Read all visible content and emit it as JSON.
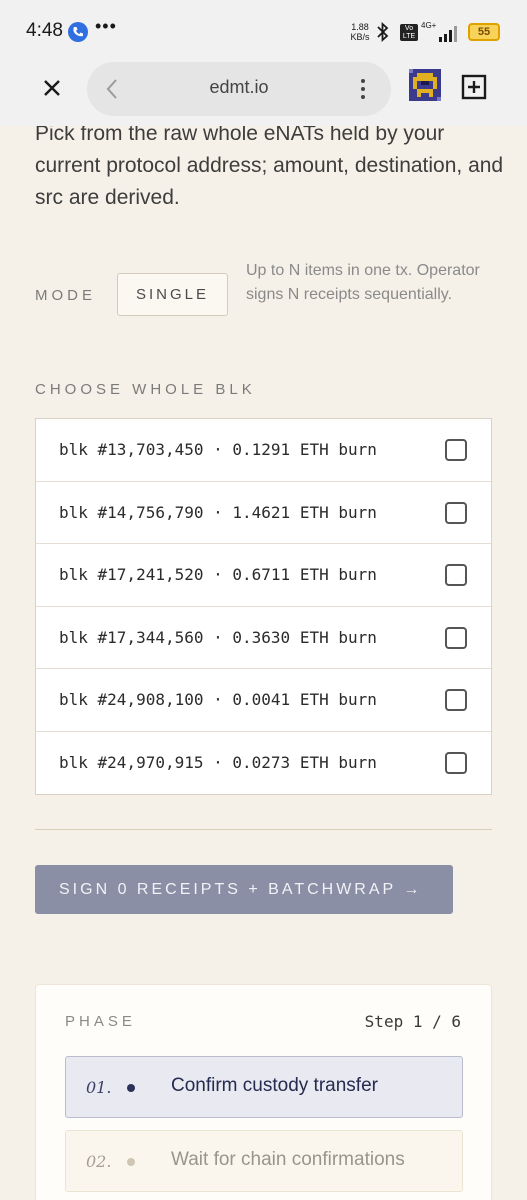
{
  "status_bar": {
    "time": "4:48",
    "overflow": "•••",
    "speed_value": "1.88",
    "speed_unit": "KB/s",
    "volte": "Vo LTE",
    "network": "4G+",
    "battery": "55"
  },
  "browser": {
    "url": "edmt.io"
  },
  "intro": {
    "text": "Pick from the raw whole eNATs held by your current protocol address; amount, destination, and src are derived."
  },
  "mode": {
    "label": "MODE",
    "value": "SINGLE",
    "hint": "Up to N items in one tx. Operator signs N receipts sequentially."
  },
  "choose": {
    "label": "CHOOSE WHOLE BLK",
    "items": [
      {
        "text": "blk #13,703,450 · 0.1291 ETH burn",
        "checked": false
      },
      {
        "text": "blk #14,756,790 · 1.4621 ETH burn",
        "checked": false
      },
      {
        "text": "blk #17,241,520 · 0.6711 ETH burn",
        "checked": false
      },
      {
        "text": "blk #17,344,560 · 0.3630 ETH burn",
        "checked": false
      },
      {
        "text": "blk #24,908,100 · 0.0041 ETH burn",
        "checked": false
      },
      {
        "text": "blk #24,970,915 · 0.0273 ETH burn",
        "checked": false
      }
    ]
  },
  "action": {
    "sign_label": "SIGN 0 RECEIPTS + BATCHWRAP →"
  },
  "phase": {
    "label": "PHASE",
    "step": "Step 1 / 6",
    "items": [
      {
        "num": "01.",
        "text": "Confirm custody transfer"
      },
      {
        "num": "02.",
        "text": "Wait for chain confirmations"
      }
    ]
  },
  "colors": {
    "page_bg": "#f6f1e8",
    "button_bg": "#8a8fa6",
    "active_step_bg": "#e9eaf1"
  }
}
